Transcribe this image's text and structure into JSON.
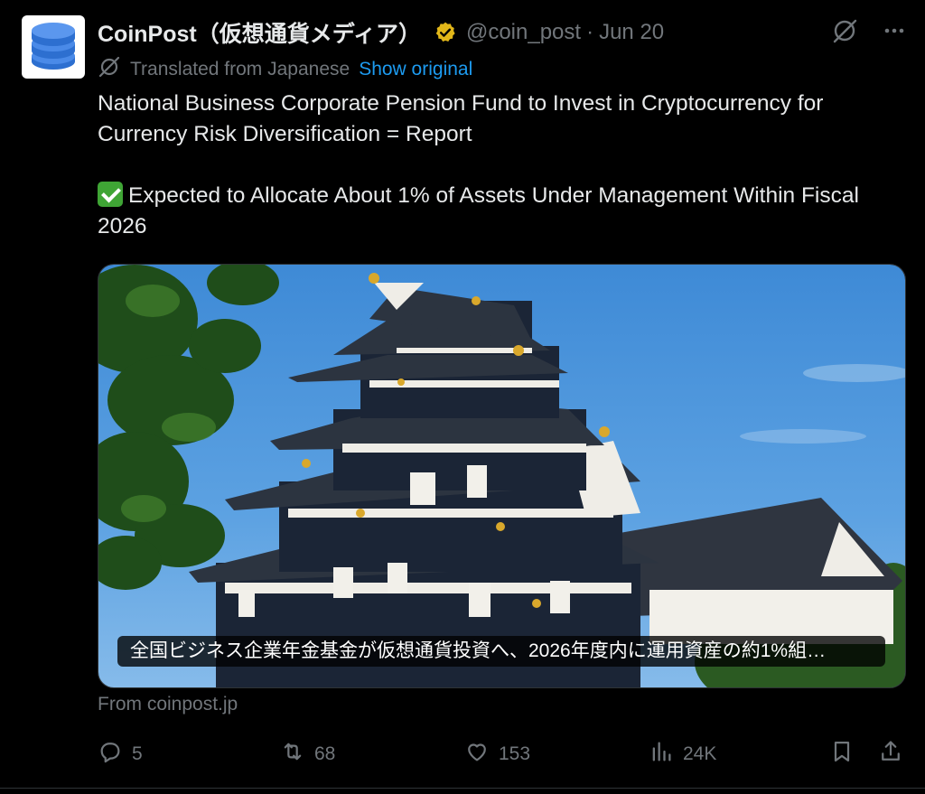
{
  "tweet": {
    "author_name": "CoinPost（仮想通貨メディア）",
    "handle": "@coin_post",
    "separator": "·",
    "date": "Jun 20",
    "translated_label": "Translated from Japanese",
    "show_original": "Show original",
    "body_line1": "National Business Corporate Pension Fund to Invest in Cryptocurrency for Currency Risk Diversification = Report",
    "body_line2": "Expected to Allocate About 1% of Assets Under Management Within Fiscal 2026",
    "card_caption": "全国ビジネス企業年金基金が仮想通貨投資へ、2026年度内に運用資産の約1%組…",
    "card_source": "From coinpost.jp"
  },
  "actions": {
    "replies": "5",
    "reposts": "68",
    "likes": "153",
    "views": "24K"
  },
  "icons": {
    "verified": "verified-badge-icon",
    "grok": "grok-icon",
    "more": "more-icon",
    "translate": "translate-icon",
    "reply": "reply-icon",
    "repost": "repost-icon",
    "like": "like-icon",
    "views": "views-icon",
    "bookmark": "bookmark-icon",
    "share": "share-icon"
  },
  "colors": {
    "background": "#000000",
    "link": "#1d9bf0",
    "muted": "#71767b",
    "verified_badge": "#e2b719"
  }
}
